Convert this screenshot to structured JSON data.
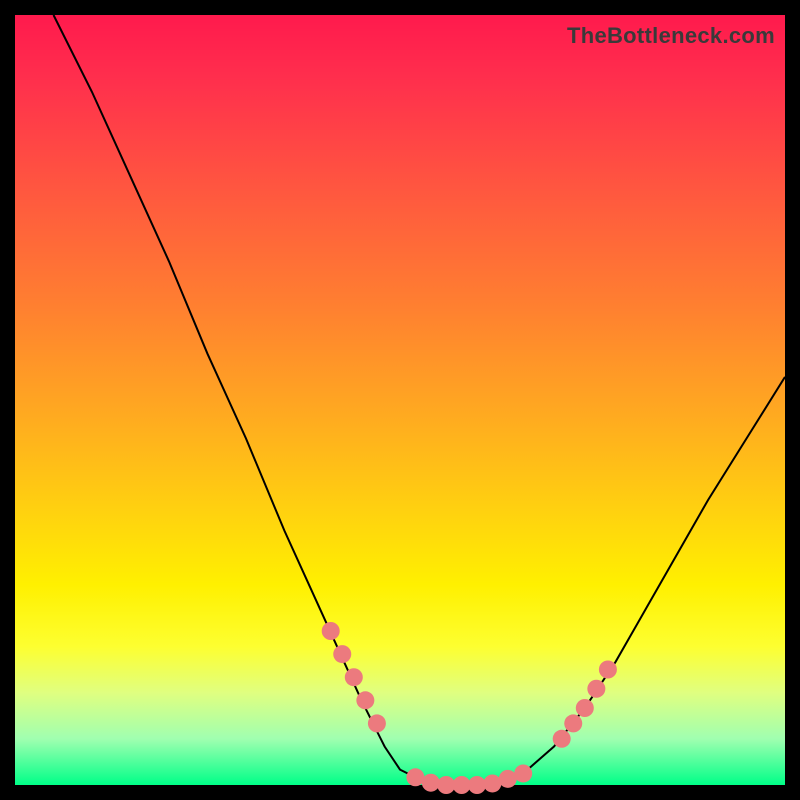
{
  "watermark": "TheBottleneck.com",
  "chart_data": {
    "type": "line",
    "title": "",
    "xlabel": "",
    "ylabel": "",
    "xlim": [
      0,
      100
    ],
    "ylim": [
      0,
      100
    ],
    "curve_points": [
      {
        "x": 5,
        "y": 100
      },
      {
        "x": 10,
        "y": 90
      },
      {
        "x": 15,
        "y": 79
      },
      {
        "x": 20,
        "y": 68
      },
      {
        "x": 25,
        "y": 56
      },
      {
        "x": 30,
        "y": 45
      },
      {
        "x": 35,
        "y": 33
      },
      {
        "x": 40,
        "y": 22
      },
      {
        "x": 45,
        "y": 11
      },
      {
        "x": 48,
        "y": 5
      },
      {
        "x": 50,
        "y": 2
      },
      {
        "x": 53,
        "y": 0.5
      },
      {
        "x": 56,
        "y": 0
      },
      {
        "x": 60,
        "y": 0
      },
      {
        "x": 63,
        "y": 0.5
      },
      {
        "x": 66,
        "y": 1.5
      },
      {
        "x": 70,
        "y": 5
      },
      {
        "x": 74,
        "y": 10
      },
      {
        "x": 78,
        "y": 16
      },
      {
        "x": 82,
        "y": 23
      },
      {
        "x": 86,
        "y": 30
      },
      {
        "x": 90,
        "y": 37
      },
      {
        "x": 95,
        "y": 45
      },
      {
        "x": 100,
        "y": 53
      }
    ],
    "markers": [
      {
        "x": 41,
        "y": 20
      },
      {
        "x": 42.5,
        "y": 17
      },
      {
        "x": 44,
        "y": 14
      },
      {
        "x": 45.5,
        "y": 11
      },
      {
        "x": 47,
        "y": 8
      },
      {
        "x": 52,
        "y": 1
      },
      {
        "x": 54,
        "y": 0.3
      },
      {
        "x": 56,
        "y": 0
      },
      {
        "x": 58,
        "y": 0
      },
      {
        "x": 60,
        "y": 0
      },
      {
        "x": 62,
        "y": 0.2
      },
      {
        "x": 64,
        "y": 0.8
      },
      {
        "x": 66,
        "y": 1.5
      },
      {
        "x": 71,
        "y": 6
      },
      {
        "x": 72.5,
        "y": 8
      },
      {
        "x": 74,
        "y": 10
      },
      {
        "x": 75.5,
        "y": 12.5
      },
      {
        "x": 77,
        "y": 15
      }
    ]
  }
}
